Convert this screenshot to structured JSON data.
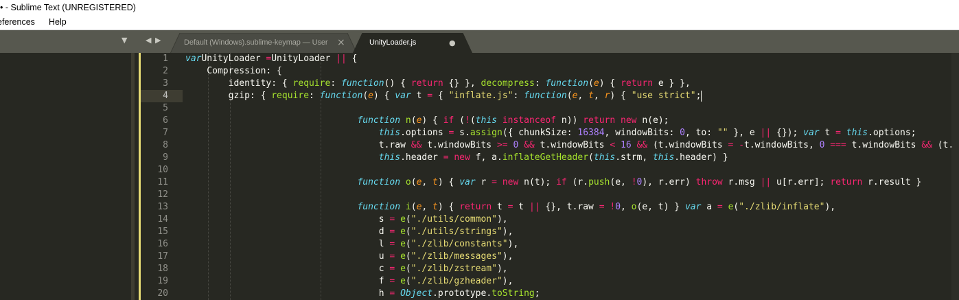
{
  "window": {
    "title": "• - Sublime Text (UNREGISTERED)"
  },
  "menu": {
    "items": [
      "eferences",
      "Help"
    ]
  },
  "tabs": [
    {
      "label": "Default (Windows).sublime-keymap — User",
      "active": false,
      "close": "×"
    },
    {
      "label": "UnityLoader.js",
      "active": true,
      "close": "●"
    }
  ],
  "tab_controls": {
    "dropdown": "▼",
    "prev": "◀",
    "next": "▶"
  },
  "editor": {
    "current_line": 4,
    "lines": [
      {
        "n": "1",
        "tokens": [
          [
            "i",
            "var"
          ],
          [
            "",
            "UnityLoader "
          ],
          [
            "k",
            "="
          ],
          [
            "",
            "UnityLoader "
          ],
          [
            "k",
            "||"
          ],
          [
            "",
            " {"
          ]
        ]
      },
      {
        "n": "2",
        "tokens": [
          [
            "",
            "    Compression: {"
          ]
        ]
      },
      {
        "n": "3",
        "tokens": [
          [
            "",
            "        identity: { "
          ],
          [
            "f",
            "require"
          ],
          [
            "",
            ": "
          ],
          [
            "i",
            "function"
          ],
          [
            "",
            "() { "
          ],
          [
            "k",
            "return"
          ],
          [
            "",
            " {} }, "
          ],
          [
            "f",
            "decompress"
          ],
          [
            "",
            ": "
          ],
          [
            "i",
            "function"
          ],
          [
            "",
            "("
          ],
          [
            "p",
            "e"
          ],
          [
            "",
            ") { "
          ],
          [
            "k",
            "return"
          ],
          [
            "",
            " e } },"
          ]
        ]
      },
      {
        "n": "4",
        "tokens": [
          [
            "",
            "        gzip: { "
          ],
          [
            "f",
            "require"
          ],
          [
            "",
            ": "
          ],
          [
            "i",
            "function"
          ],
          [
            "",
            "("
          ],
          [
            "p",
            "e"
          ],
          [
            "",
            ") { "
          ],
          [
            "i",
            "var"
          ],
          [
            "",
            " t "
          ],
          [
            "k",
            "="
          ],
          [
            "",
            " { "
          ],
          [
            "s",
            "\"inflate.js\""
          ],
          [
            "",
            ": "
          ],
          [
            "i",
            "function"
          ],
          [
            "",
            "("
          ],
          [
            "p",
            "e"
          ],
          [
            ", ",
            ", "
          ],
          [
            "p",
            "t"
          ],
          [
            ", ",
            ", "
          ],
          [
            "p",
            "r"
          ],
          [
            "",
            ") { "
          ],
          [
            "s",
            "\"use strict\""
          ],
          [
            "",
            ";"
          ]
        ]
      },
      {
        "n": "5",
        "tokens": []
      },
      {
        "n": "6",
        "tokens": [
          [
            "",
            "                                "
          ],
          [
            "i",
            "function"
          ],
          [
            " ",
            " "
          ],
          [
            "f",
            "n"
          ],
          [
            "",
            "("
          ],
          [
            "p",
            "e"
          ],
          [
            "",
            ") { "
          ],
          [
            "k",
            "if"
          ],
          [
            "",
            " ("
          ],
          [
            "k",
            "!"
          ],
          [
            "",
            "("
          ],
          [
            "i",
            "this"
          ],
          [
            " ",
            " "
          ],
          [
            "k",
            "instanceof"
          ],
          [
            "",
            " n)) "
          ],
          [
            "k",
            "return"
          ],
          [
            " ",
            " "
          ],
          [
            "k",
            "new"
          ],
          [
            "",
            " n(e);"
          ]
        ]
      },
      {
        "n": "7",
        "tokens": [
          [
            "",
            "                                    "
          ],
          [
            "i",
            "this"
          ],
          [
            "",
            ".options "
          ],
          [
            "k",
            "="
          ],
          [
            "",
            " s."
          ],
          [
            "f",
            "assign"
          ],
          [
            "",
            "({ chunkSize: "
          ],
          [
            "n",
            "16384"
          ],
          [
            "",
            ", windowBits: "
          ],
          [
            "n",
            "0"
          ],
          [
            "",
            ", to: "
          ],
          [
            "s",
            "\"\""
          ],
          [
            "",
            " }, e "
          ],
          [
            "k",
            "||"
          ],
          [
            "",
            " {}); "
          ],
          [
            "i",
            "var"
          ],
          [
            "",
            " t "
          ],
          [
            "k",
            "="
          ],
          [
            " ",
            " "
          ],
          [
            "i",
            "this"
          ],
          [
            "",
            ".options;"
          ]
        ]
      },
      {
        "n": "8",
        "tokens": [
          [
            "",
            "                                    t.raw "
          ],
          [
            "k",
            "&&"
          ],
          [
            "",
            " t.windowBits "
          ],
          [
            "k",
            ">="
          ],
          [
            " ",
            " "
          ],
          [
            "n",
            "0"
          ],
          [
            " ",
            " "
          ],
          [
            "k",
            "&&"
          ],
          [
            "",
            " t.windowBits "
          ],
          [
            "k",
            "<"
          ],
          [
            " ",
            " "
          ],
          [
            "n",
            "16"
          ],
          [
            " ",
            " "
          ],
          [
            "k",
            "&&"
          ],
          [
            "",
            " (t.windowBits "
          ],
          [
            "k",
            "="
          ],
          [
            " ",
            " "
          ],
          [
            "k",
            "-"
          ],
          [
            "",
            "t.windowBits, "
          ],
          [
            "n",
            "0"
          ],
          [
            " ",
            " "
          ],
          [
            "k",
            "==="
          ],
          [
            "",
            " t.windowBits "
          ],
          [
            "k",
            "&&"
          ],
          [
            "",
            " (t.wi"
          ]
        ]
      },
      {
        "n": "9",
        "tokens": [
          [
            "",
            "                                    "
          ],
          [
            "i",
            "this"
          ],
          [
            "",
            ".header "
          ],
          [
            "k",
            "="
          ],
          [
            " ",
            " "
          ],
          [
            "k",
            "new"
          ],
          [
            "",
            " f, a."
          ],
          [
            "f",
            "inflateGetHeader"
          ],
          [
            "",
            "("
          ],
          [
            "i",
            "this"
          ],
          [
            "",
            ".strm, "
          ],
          [
            "i",
            "this"
          ],
          [
            "",
            ".header) }"
          ]
        ]
      },
      {
        "n": "10",
        "tokens": []
      },
      {
        "n": "11",
        "tokens": [
          [
            "",
            "                                "
          ],
          [
            "i",
            "function"
          ],
          [
            " ",
            " "
          ],
          [
            "f",
            "o"
          ],
          [
            "",
            "("
          ],
          [
            "p",
            "e"
          ],
          [
            ", ",
            ", "
          ],
          [
            "p",
            "t"
          ],
          [
            "",
            ") { "
          ],
          [
            "i",
            "var"
          ],
          [
            "",
            " r "
          ],
          [
            "k",
            "="
          ],
          [
            " ",
            " "
          ],
          [
            "k",
            "new"
          ],
          [
            "",
            " n(t); "
          ],
          [
            "k",
            "if"
          ],
          [
            "",
            " (r."
          ],
          [
            "f",
            "push"
          ],
          [
            "",
            "(e, "
          ],
          [
            "k",
            "!"
          ],
          [
            "n",
            "0"
          ],
          [
            "",
            "), r.err) "
          ],
          [
            "k",
            "throw"
          ],
          [
            "",
            " r.msg "
          ],
          [
            "k",
            "||"
          ],
          [
            "",
            " u[r.err]; "
          ],
          [
            "k",
            "return"
          ],
          [
            "",
            " r.result }"
          ]
        ]
      },
      {
        "n": "12",
        "tokens": []
      },
      {
        "n": "13",
        "tokens": [
          [
            "",
            "                                "
          ],
          [
            "i",
            "function"
          ],
          [
            " ",
            " "
          ],
          [
            "f",
            "i"
          ],
          [
            "",
            "("
          ],
          [
            "p",
            "e"
          ],
          [
            ", ",
            ", "
          ],
          [
            "p",
            "t"
          ],
          [
            "",
            ") { "
          ],
          [
            "k",
            "return"
          ],
          [
            "",
            " t "
          ],
          [
            "k",
            "="
          ],
          [
            "",
            " t "
          ],
          [
            "k",
            "||"
          ],
          [
            "",
            " {}, t.raw "
          ],
          [
            "k",
            "="
          ],
          [
            " ",
            " "
          ],
          [
            "k",
            "!"
          ],
          [
            "n",
            "0"
          ],
          [
            "",
            ", "
          ],
          [
            "f",
            "o"
          ],
          [
            "",
            "(e, t) } "
          ],
          [
            "i",
            "var"
          ],
          [
            "",
            " a "
          ],
          [
            "k",
            "="
          ],
          [
            " ",
            " "
          ],
          [
            "f",
            "e"
          ],
          [
            "",
            "("
          ],
          [
            "s",
            "\"./zlib/inflate\""
          ],
          [
            "",
            "),"
          ]
        ]
      },
      {
        "n": "14",
        "tokens": [
          [
            "",
            "                                    s "
          ],
          [
            "k",
            "="
          ],
          [
            " ",
            " "
          ],
          [
            "f",
            "e"
          ],
          [
            "",
            "("
          ],
          [
            "s",
            "\"./utils/common\""
          ],
          [
            "",
            "),"
          ]
        ]
      },
      {
        "n": "15",
        "tokens": [
          [
            "",
            "                                    d "
          ],
          [
            "k",
            "="
          ],
          [
            " ",
            " "
          ],
          [
            "f",
            "e"
          ],
          [
            "",
            "("
          ],
          [
            "s",
            "\"./utils/strings\""
          ],
          [
            "",
            "),"
          ]
        ]
      },
      {
        "n": "16",
        "tokens": [
          [
            "",
            "                                    l "
          ],
          [
            "k",
            "="
          ],
          [
            " ",
            " "
          ],
          [
            "f",
            "e"
          ],
          [
            "",
            "("
          ],
          [
            "s",
            "\"./zlib/constants\""
          ],
          [
            "",
            "),"
          ]
        ]
      },
      {
        "n": "17",
        "tokens": [
          [
            "",
            "                                    u "
          ],
          [
            "k",
            "="
          ],
          [
            " ",
            " "
          ],
          [
            "f",
            "e"
          ],
          [
            "",
            "("
          ],
          [
            "s",
            "\"./zlib/messages\""
          ],
          [
            "",
            "),"
          ]
        ]
      },
      {
        "n": "18",
        "tokens": [
          [
            "",
            "                                    c "
          ],
          [
            "k",
            "="
          ],
          [
            " ",
            " "
          ],
          [
            "f",
            "e"
          ],
          [
            "",
            "("
          ],
          [
            "s",
            "\"./zlib/zstream\""
          ],
          [
            "",
            "),"
          ]
        ]
      },
      {
        "n": "19",
        "tokens": [
          [
            "",
            "                                    f "
          ],
          [
            "k",
            "="
          ],
          [
            " ",
            " "
          ],
          [
            "f",
            "e"
          ],
          [
            "",
            "("
          ],
          [
            "s",
            "\"./zlib/gzheader\""
          ],
          [
            "",
            "),"
          ]
        ]
      },
      {
        "n": "20",
        "tokens": [
          [
            "",
            "                                    h "
          ],
          [
            "k",
            "="
          ],
          [
            " ",
            " "
          ],
          [
            "i",
            "Object"
          ],
          [
            "",
            ".prototype."
          ],
          [
            "f",
            "toString"
          ],
          [
            "",
            ";"
          ]
        ]
      }
    ]
  },
  "colors": {
    "background": "#272822",
    "foreground": "#f8f8f2",
    "keyword": "#f92672",
    "string": "#e6db74",
    "number": "#ae81ff",
    "function": "#a6e22e",
    "storage": "#66d9ef",
    "parameter": "#fd971f",
    "line_number": "#90908a",
    "tabbar": "#57584f"
  }
}
